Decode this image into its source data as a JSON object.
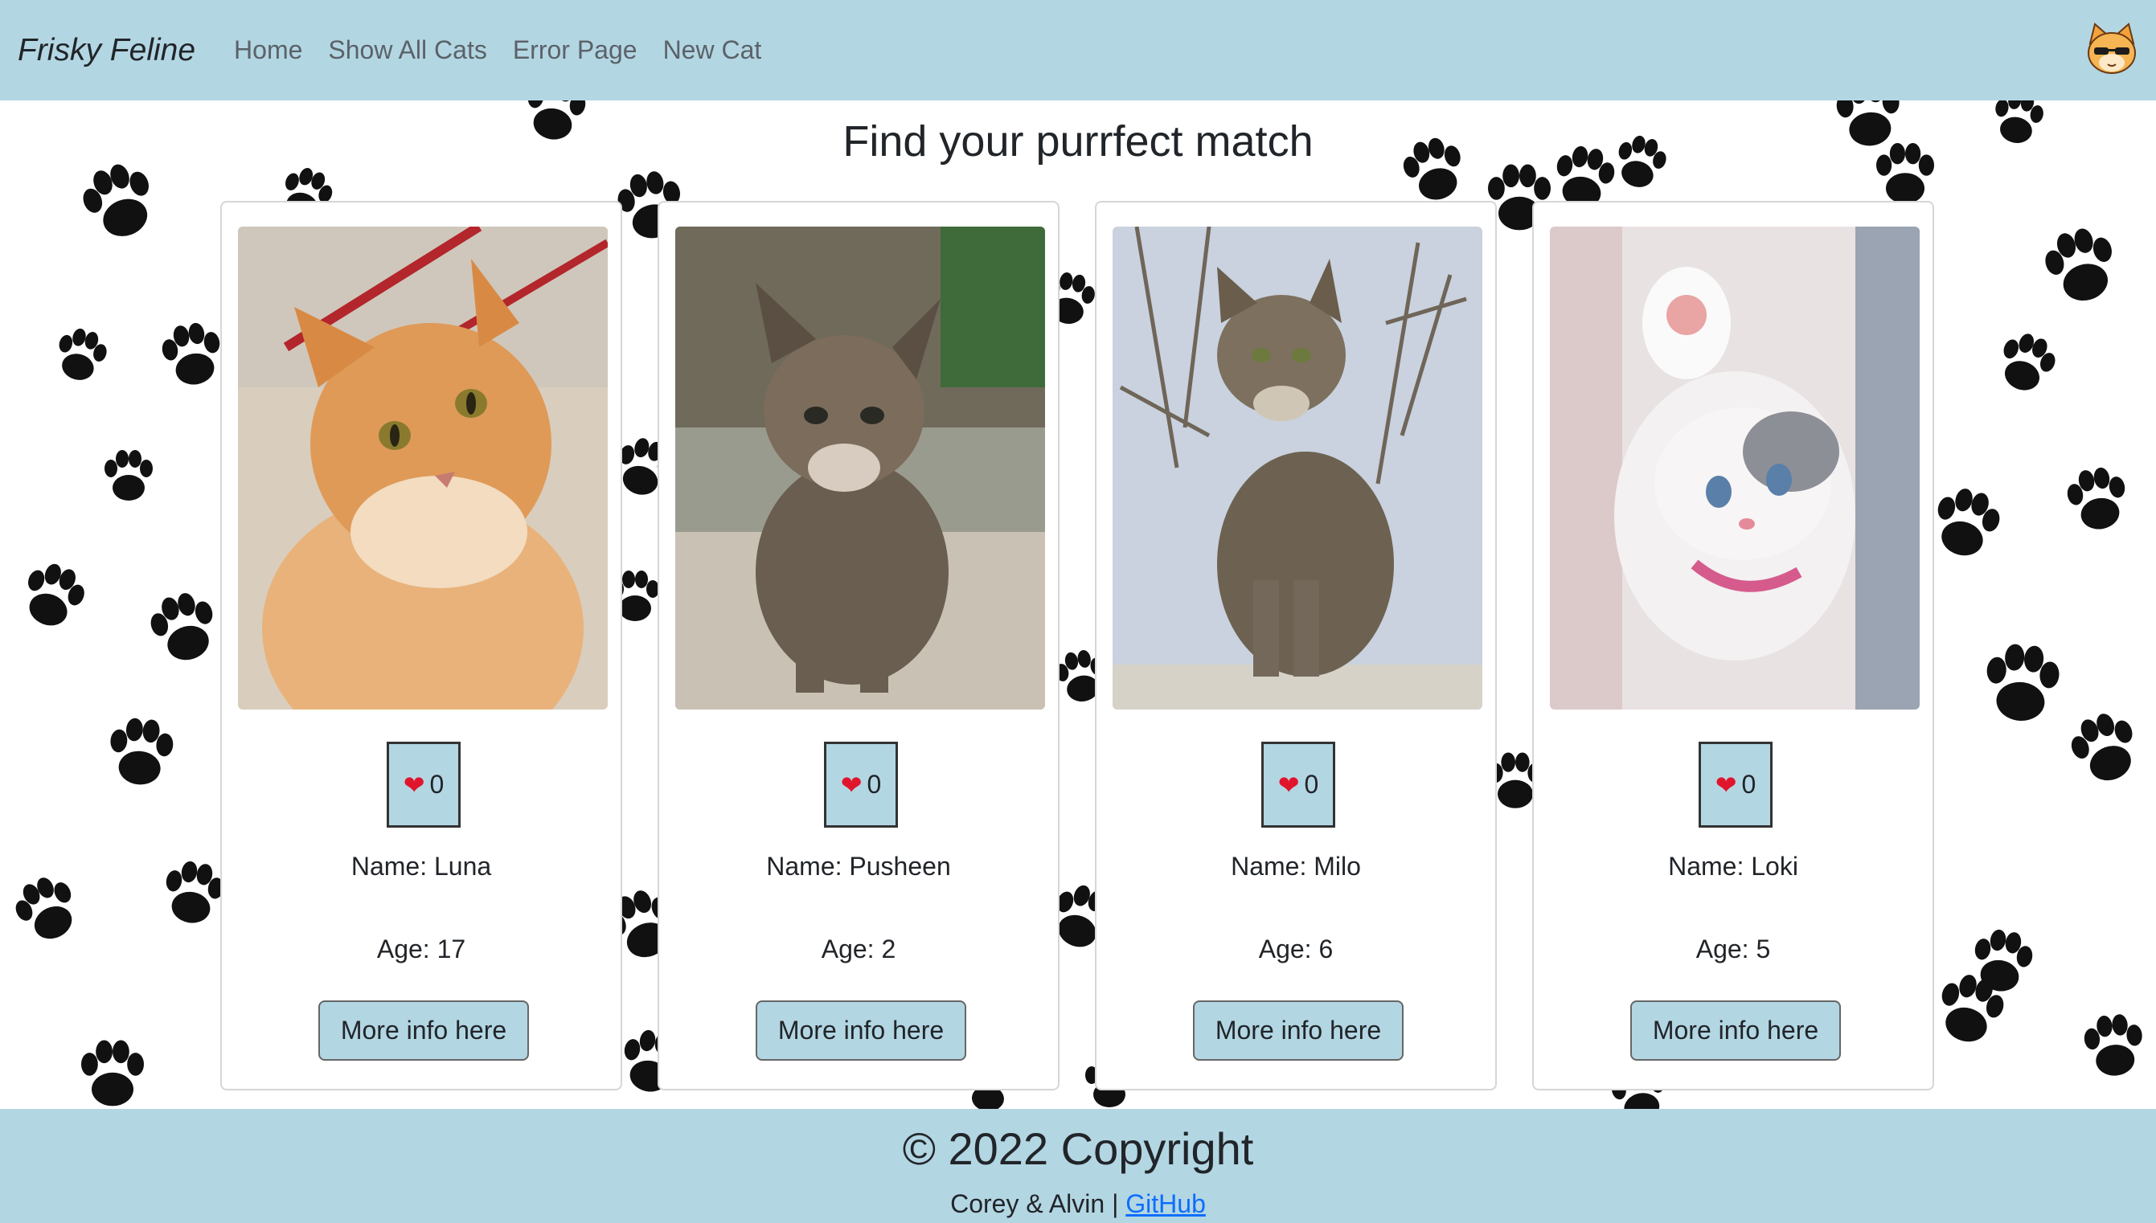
{
  "nav": {
    "brand": "Frisky Feline",
    "links": [
      "Home",
      "Show All Cats",
      "Error Page",
      "New Cat"
    ],
    "avatar_icon": "cool-cat-avatar-icon"
  },
  "main": {
    "heading": "Find your purrfect match"
  },
  "cats": [
    {
      "name_text": "Name: Luna",
      "age_text": "Age: 17",
      "likes": "0",
      "button_label": "More info here",
      "photo_desc": "orange-tabby-cat"
    },
    {
      "name_text": "Name: Pusheen",
      "age_text": "Age: 2",
      "likes": "0",
      "button_label": "More info here",
      "photo_desc": "tabby-kitten"
    },
    {
      "name_text": "Name: Milo",
      "age_text": "Age: 6",
      "likes": "0",
      "button_label": "More info here",
      "photo_desc": "grey-tabby-cat"
    },
    {
      "name_text": "Name: Loki",
      "age_text": "Age: 5",
      "likes": "0",
      "button_label": "More info here",
      "photo_desc": "white-grey-kitten"
    }
  ],
  "footer": {
    "copyright": "© 2022 Copyright",
    "credits": "Corey & Alvin |",
    "link_label": "GitHub"
  },
  "colors": {
    "nav_bg": "#b3d6e3",
    "button_bg": "#b3d6e3",
    "heart": "#e0152b",
    "link": "#0d6efd"
  }
}
